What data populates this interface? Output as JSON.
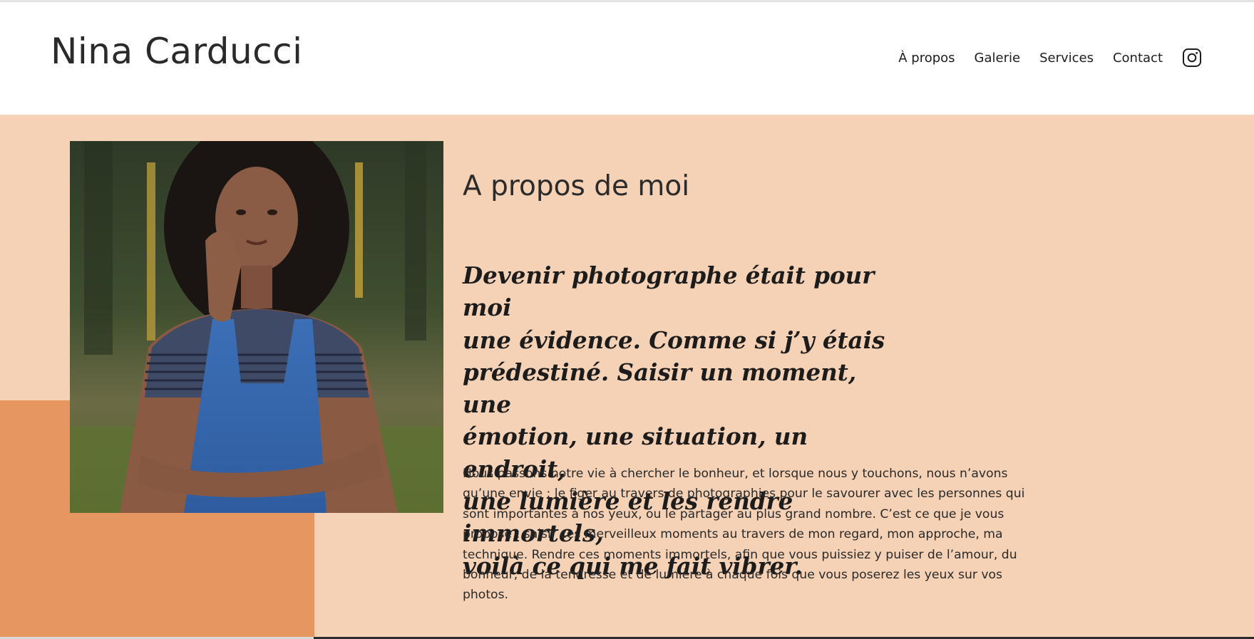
{
  "header": {
    "brand": "Nina Carducci",
    "nav": [
      {
        "label": "À propos"
      },
      {
        "label": "Galerie"
      },
      {
        "label": "Services"
      },
      {
        "label": "Contact"
      }
    ],
    "social_icon": "instagram-icon"
  },
  "about": {
    "title": "A propos de moi",
    "quote_lines": [
      "Devenir photographe était pour moi",
      "une évidence. Comme si j’y étais",
      "prédestiné. Saisir un moment, une",
      "émotion, une situation, un endroit,",
      "une lumière et les rendre immortels,",
      "voilà ce qui me fait vibrer."
    ],
    "body": "Nous passons notre vie à chercher le bonheur, et lorsque nous y touchons, nous n’avons qu’une envie : le figer au travers de photographies pour le savourer avec les personnes qui sont importantes à nos yeux, ou le partager au plus grand nombre. C’est ce que je vous propose : saisir ces merveilleux moments au travers de mon regard, mon approche, ma technique. Rendre ces moments immortels, afin que vous puissiez y puiser de l’amour, du bonheur, de la tendresse et de lumière à chaque fois que vous poserez les yeux sur vos photos."
  },
  "colors": {
    "section_bg": "#f5d1b6",
    "accent_block": "#e5975f",
    "text": "#222222"
  }
}
